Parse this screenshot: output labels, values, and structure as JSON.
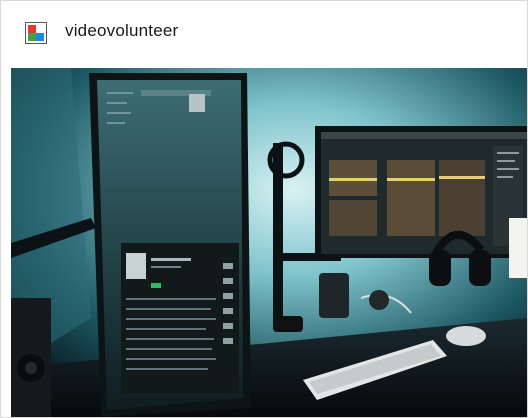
{
  "window": {
    "title": "videovolunteer",
    "app_icon": "app-logo-icon"
  },
  "photo": {
    "subject": "desk-setup-photo"
  }
}
